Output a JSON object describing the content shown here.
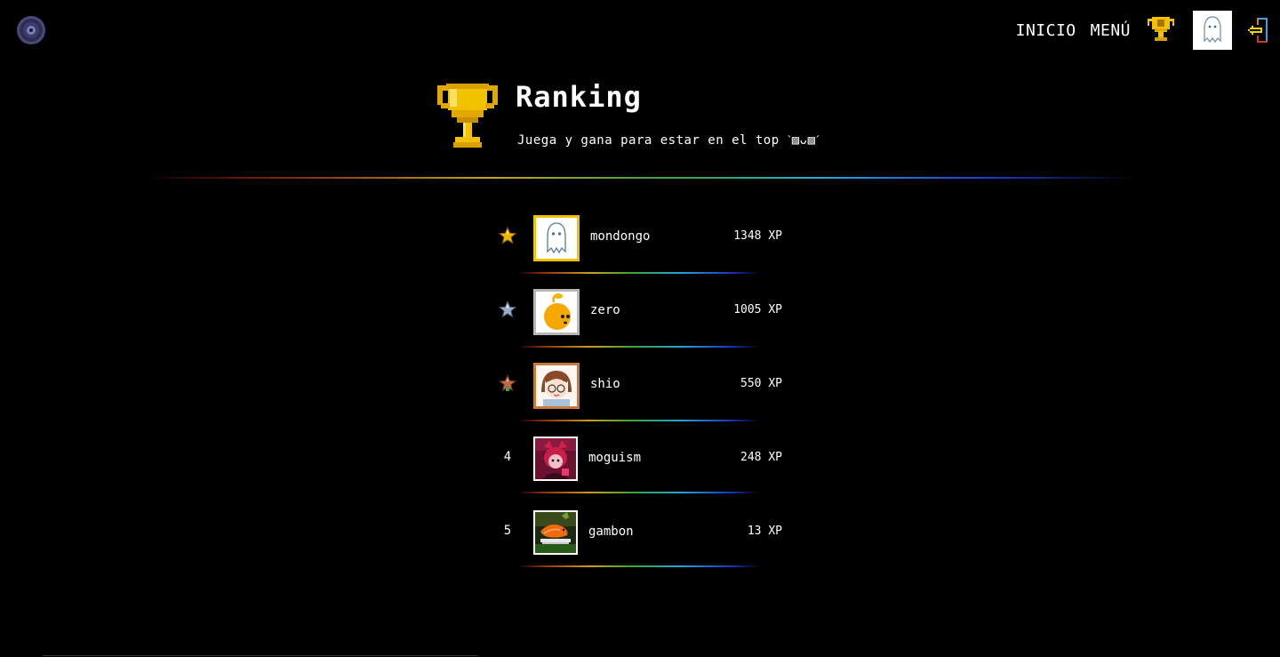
{
  "nav": {
    "logo_icon": "vinyl-disc-icon",
    "links": [
      "INICIO",
      "MENÚ"
    ],
    "trophy_icon": "trophy-icon",
    "avatar_icon": "ghost-avatar",
    "logout_icon": "logout-icon"
  },
  "header": {
    "title": "Ranking",
    "subtitle": "Juega y gana para estar en el top ˋ▨ᴗ▨ˊ"
  },
  "colors": {
    "background": "#000000",
    "text": "#ffffff",
    "gold": "#f2c200",
    "silver": "#b8b8b8",
    "bronze": "#c8783a"
  },
  "ranking": [
    {
      "rank": "",
      "rank_icon": "gold-star-icon",
      "username": "mondongo",
      "xp": "1348 XP",
      "avatar": "ghost-avatar",
      "frame": "gold"
    },
    {
      "rank": "",
      "rank_icon": "silver-star-icon",
      "username": "zero",
      "xp": "1005 XP",
      "avatar": "orange-creature-avatar",
      "frame": "silver"
    },
    {
      "rank": "",
      "rank_icon": "bronze-star-icon",
      "username": "shio",
      "xp": "550 XP",
      "avatar": "girl-glasses-avatar",
      "frame": "bronze"
    },
    {
      "rank": "4",
      "rank_icon": "",
      "username": "moguism",
      "xp": "248 XP",
      "avatar": "red-character-avatar",
      "frame": "white"
    },
    {
      "rank": "5",
      "rank_icon": "",
      "username": "gambon",
      "xp": "13 XP",
      "avatar": "shrimp-photo-avatar",
      "frame": "white"
    }
  ]
}
